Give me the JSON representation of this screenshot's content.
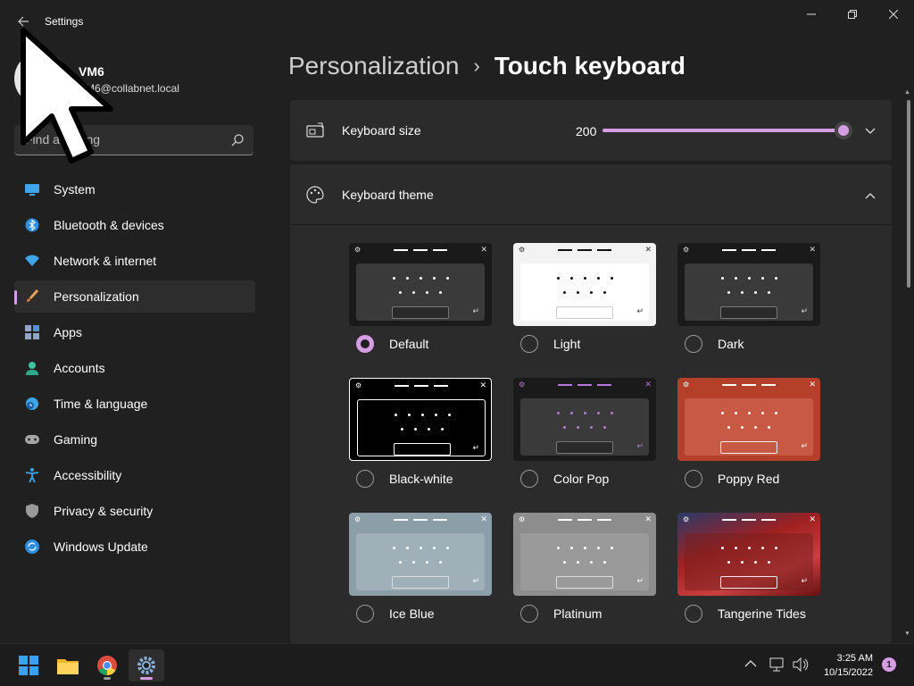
{
  "window": {
    "title": "Settings",
    "back_icon": "arrow-left-icon"
  },
  "profile": {
    "name": "VM6",
    "email": "VM6@collabnet.local"
  },
  "search": {
    "placeholder": "Find a setting"
  },
  "sidebar": {
    "items": [
      {
        "label": "System",
        "icon": "monitor-icon",
        "active": false
      },
      {
        "label": "Bluetooth & devices",
        "icon": "bluetooth-icon",
        "active": false
      },
      {
        "label": "Network & internet",
        "icon": "wifi-icon",
        "active": false
      },
      {
        "label": "Personalization",
        "icon": "brush-icon",
        "active": true
      },
      {
        "label": "Apps",
        "icon": "apps-icon",
        "active": false
      },
      {
        "label": "Accounts",
        "icon": "person-icon",
        "active": false
      },
      {
        "label": "Time & language",
        "icon": "clock-globe-icon",
        "active": false
      },
      {
        "label": "Gaming",
        "icon": "gamepad-icon",
        "active": false
      },
      {
        "label": "Accessibility",
        "icon": "accessibility-icon",
        "active": false
      },
      {
        "label": "Privacy & security",
        "icon": "shield-icon",
        "active": false
      },
      {
        "label": "Windows Update",
        "icon": "update-icon",
        "active": false
      }
    ]
  },
  "breadcrumb": {
    "parent": "Personalization",
    "separator": "›",
    "current": "Touch keyboard"
  },
  "keyboard_size": {
    "label": "Keyboard size",
    "value": "200",
    "slider_fraction": 0.97
  },
  "keyboard_theme": {
    "label": "Keyboard theme",
    "selected": "Default",
    "themes": [
      {
        "name": "Default"
      },
      {
        "name": "Light"
      },
      {
        "name": "Dark"
      },
      {
        "name": "Black-white"
      },
      {
        "name": "Color Pop"
      },
      {
        "name": "Poppy Red"
      },
      {
        "name": "Ice Blue"
      },
      {
        "name": "Platinum"
      },
      {
        "name": "Tangerine Tides"
      }
    ]
  },
  "taskbar": {
    "apps": [
      "start-icon",
      "file-explorer-icon",
      "chrome-icon",
      "settings-icon"
    ],
    "time": "3:25 AM",
    "date": "10/15/2022",
    "notification_count": "1"
  },
  "colors": {
    "accent": "#d59de3",
    "background": "#202020",
    "card": "#2b2b2b"
  }
}
